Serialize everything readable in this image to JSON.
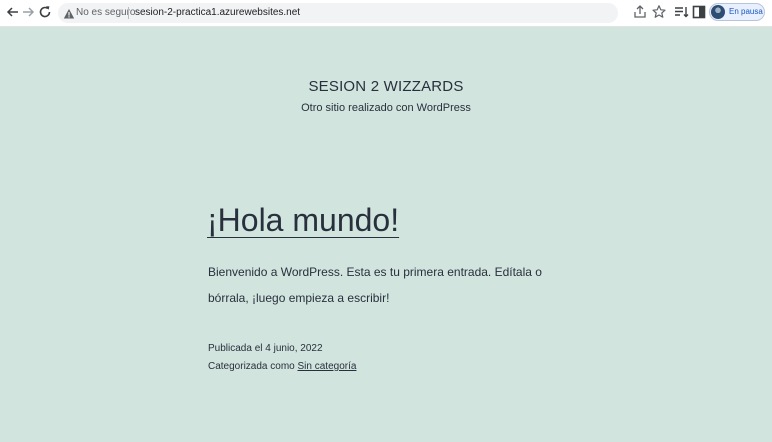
{
  "browser": {
    "security_label": "No es seguro",
    "url": "sesion-2-practica1.azurewebsites.net",
    "profile_status": "En pausa"
  },
  "site": {
    "title": "SESION 2 WIZZARDS",
    "description": "Otro sitio realizado con WordPress"
  },
  "post": {
    "title": "¡Hola mundo!",
    "content": "Bienvenido a WordPress. Esta es tu primera entrada. Edítala o bórrala, ¡luego empieza a escribir!",
    "published": "Publicada el 4 junio, 2022",
    "category_prefix": "Categorizada como ",
    "category": "Sin categoría"
  },
  "colors": {
    "page_background": "#d1e4dd",
    "text": "#28303d"
  }
}
